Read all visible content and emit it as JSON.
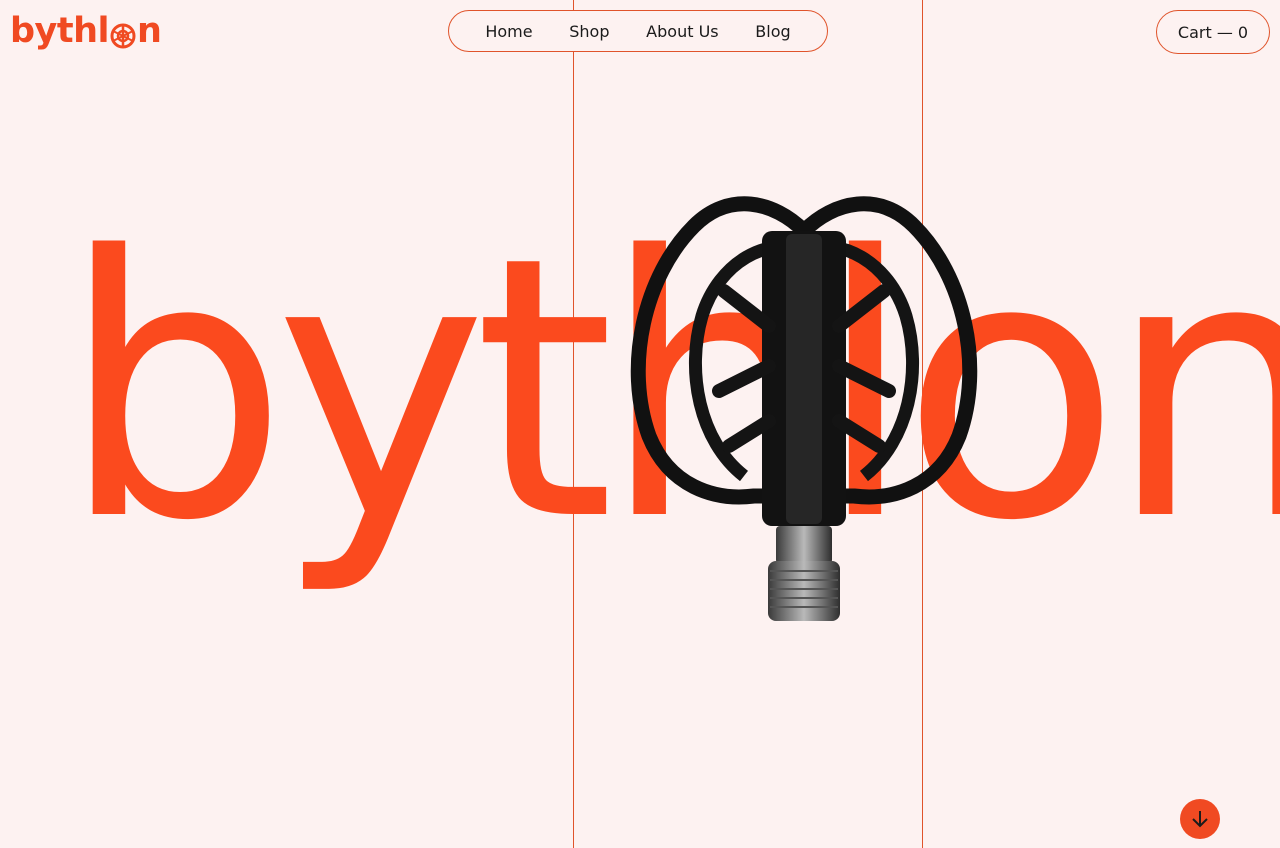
{
  "brand": {
    "logo_text_prefix": "byth",
    "logo_text_suffix": "l",
    "logo_text_end": "n",
    "hero_word": "bythlon",
    "accent_color": "#f04a22",
    "background_color": "#fdf2f1"
  },
  "nav": {
    "items": [
      {
        "label": "Home"
      },
      {
        "label": "Shop"
      },
      {
        "label": "About Us"
      },
      {
        "label": "Blog"
      }
    ]
  },
  "cart": {
    "label": "Cart — 0"
  },
  "hero": {
    "product_image": "bike-pedal",
    "scroll_icon": "arrow-down-icon"
  }
}
